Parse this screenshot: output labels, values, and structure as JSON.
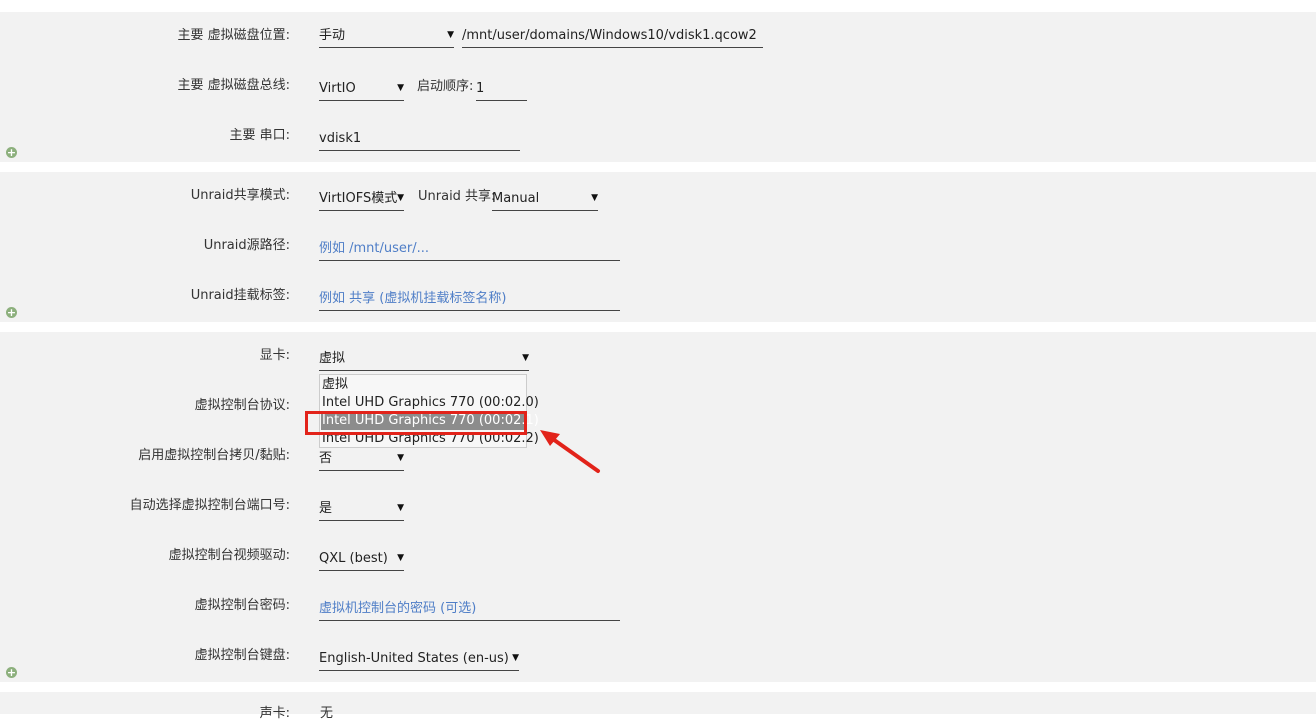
{
  "disk": {
    "location_label": "主要 虚拟磁盘位置:",
    "location_value": "手动",
    "path_value": "/mnt/user/domains/Windows10/vdisk1.qcow2",
    "bus_label": "主要 虚拟磁盘总线:",
    "bus_value": "VirtIO",
    "boot_order_label": "启动顺序:",
    "boot_order_value": "1",
    "serial_label": "主要 串口:",
    "serial_value": "vdisk1"
  },
  "share": {
    "mode_label": "Unraid共享模式:",
    "mode_value": "VirtIOFS模式",
    "share_label": "Unraid 共享:",
    "share_value": "Manual",
    "source_label": "Unraid源路径:",
    "source_placeholder": "例如 /mnt/user/...",
    "tag_label": "Unraid挂载标签:",
    "tag_placeholder": "例如 共享 (虚拟机挂载标签名称)"
  },
  "graphics": {
    "gpu_label": "显卡:",
    "gpu_value": "虚拟",
    "gpu_options": [
      "虚拟",
      "Intel UHD Graphics 770 (00:02.0)",
      "Intel UHD Graphics 770 (00:02.1)",
      "Intel UHD Graphics 770 (00:02.2)"
    ],
    "gpu_selected_index": 2,
    "console_protocol_label": "虚拟控制台协议:",
    "clipboard_label": "启用虚拟控制台拷贝/黏贴:",
    "clipboard_value": "否",
    "autoport_label": "自动选择虚拟控制台端口号:",
    "autoport_value": "是",
    "video_driver_label": "虚拟控制台视频驱动:",
    "video_driver_value": "QXL (best)",
    "password_label": "虚拟控制台密码:",
    "password_placeholder": "虚拟机控制台的密码 (可选)",
    "keyboard_label": "虚拟控制台键盘:",
    "keyboard_value": "English-United States (en-us)"
  },
  "sound": {
    "label": "声卡:",
    "value": "无"
  },
  "icons": {
    "add": "plus-circle-icon",
    "dropdown": "caret-down-icon",
    "annotation": "red-arrow"
  },
  "colors": {
    "section_bg": "#f2f2f2",
    "placeholder": "#4f7ec7",
    "highlight": "#e2231a",
    "selected_option_bg": "#8c8c8c",
    "add_icon": "#8db07d"
  }
}
